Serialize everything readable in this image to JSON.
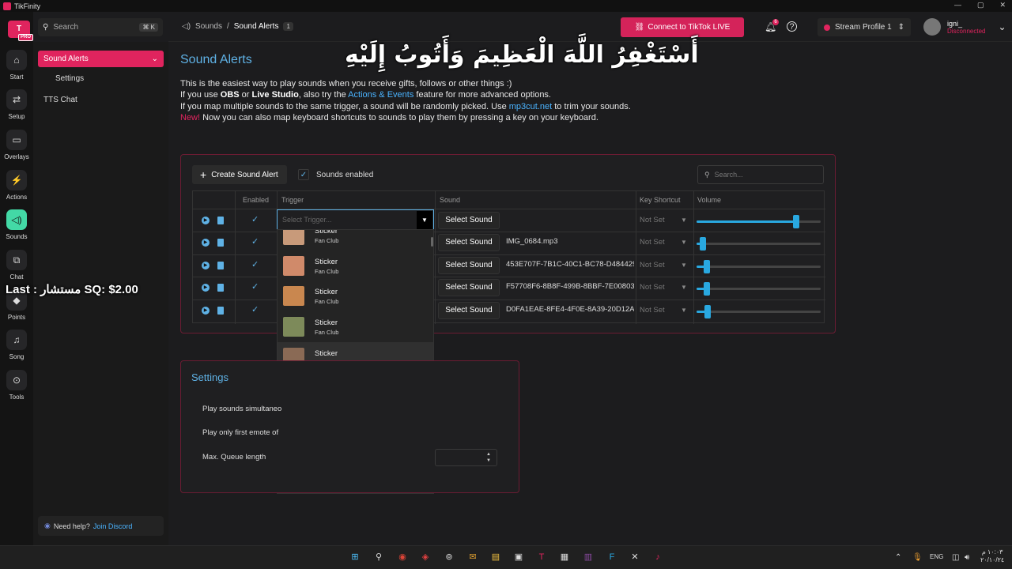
{
  "window": {
    "title": "TikFinity"
  },
  "brand": {
    "logo_text": "T",
    "badge": "PRO"
  },
  "rail": {
    "items": [
      {
        "label": "Start",
        "icon": "home-icon",
        "glyph": "⌂"
      },
      {
        "label": "Setup",
        "icon": "toggle-icon",
        "glyph": "⇄"
      },
      {
        "label": "Overlays",
        "icon": "monitor-icon",
        "glyph": "▭"
      },
      {
        "label": "Actions",
        "icon": "bolt-icon",
        "glyph": "⚡"
      },
      {
        "label": "Sounds",
        "icon": "speaker-icon",
        "glyph": "◁)"
      },
      {
        "label": "Chat",
        "icon": "chat-icon",
        "glyph": "⧉"
      },
      {
        "label": "Points",
        "icon": "points-icon",
        "glyph": "◆"
      },
      {
        "label": "Song",
        "icon": "music-icon",
        "glyph": "♫"
      },
      {
        "label": "Tools",
        "icon": "gamepad-icon",
        "glyph": "⊙"
      }
    ]
  },
  "sidebar": {
    "search_placeholder": "Search",
    "search_shortcut": "⌘ K",
    "main_item": "Sound Alerts",
    "sub_item": "Settings",
    "tts_item": "TTS Chat",
    "help_text": "Need help?",
    "help_link": "Join Discord"
  },
  "topbar": {
    "breadcrumb_root": "Sounds",
    "breadcrumb_sep": "/",
    "breadcrumb_current": "Sound Alerts",
    "breadcrumb_badge": "1",
    "connect_label": "Connect to TikTok LIVE",
    "notif_count": "6",
    "profile": "Stream Profile 1",
    "user_name": "igni_",
    "user_status": "Disconnected"
  },
  "page": {
    "title": "Sound Alerts",
    "desc_line1": "This is the easiest way to play sounds when you receive gifts, follows or other things :)",
    "desc_l2_a": "If you use ",
    "desc_l2_obs": "OBS",
    "desc_l2_b": " or ",
    "desc_l2_ls": "Live Studio",
    "desc_l2_c": ", also try the ",
    "desc_l2_link": "Actions & Events",
    "desc_l2_d": " feature for more advanced options.",
    "desc_l3_a": "If you map multiple sounds to the same trigger, a sound will be randomly picked. Use ",
    "desc_l3_link": "mp3cut.net",
    "desc_l3_b": " to trim your sounds.",
    "desc_l4_new": "New!",
    "desc_l4_text": " Now you can also map keyboard shortcuts to sounds to play them by pressing a key on your keyboard."
  },
  "alerts": {
    "create_label": "Create Sound Alert",
    "sounds_enabled_label": "Sounds enabled",
    "search_placeholder": "Search...",
    "columns": [
      "Enabled",
      "Trigger",
      "Sound",
      "Key Shortcut",
      "Volume"
    ],
    "trigger_placeholder": "Select Trigger...",
    "rows": [
      {
        "select_label": "Select Sound",
        "file": "",
        "key": "Not Set",
        "volume": 0.8
      },
      {
        "select_label": "Select Sound",
        "file": "IMG_0684.mp3",
        "key": "Not Set",
        "volume": 0.05
      },
      {
        "select_label": "Select Sound",
        "file": "453E707F-7B1C-40C1-BC78-D484429...",
        "key": "Not Set",
        "volume": 0.08
      },
      {
        "select_label": "Select Sound",
        "file": "F57708F6-8B8F-499B-8BBF-7E00803...",
        "key": "Not Set",
        "volume": 0.08
      },
      {
        "select_label": "Select Sound",
        "file": "D0FA1EAE-8FE4-4F0E-8A39-20D12A9...",
        "key": "Not Set",
        "volume": 0.09
      }
    ],
    "dropdown_items": [
      {
        "label": "Sticker",
        "sub": "Fan Club",
        "color": "#c89a7a"
      },
      {
        "label": "Sticker",
        "sub": "Fan Club",
        "color": "#d08a6a"
      },
      {
        "label": "Sticker",
        "sub": "Fan Club",
        "color": "#c9874f"
      },
      {
        "label": "Sticker",
        "sub": "Fan Club",
        "color": "#7d8a5a"
      },
      {
        "label": "Sticker",
        "sub": "Fan Club",
        "color": "#8a6a55"
      },
      {
        "label": "Sticker",
        "sub": "Fan Club",
        "color": "#6a4a3a"
      },
      {
        "label": "Sticker",
        "sub": "Fan Club",
        "color": "#8a6a8a"
      },
      {
        "label": "Sticker",
        "sub": "Fan Club",
        "color": "#6a8a5a"
      },
      {
        "label": "Sticker",
        "sub": "Fan Club",
        "color": "#dcdcdc"
      }
    ]
  },
  "settings": {
    "title": "Settings",
    "opt1": "Play sounds simultaneo",
    "opt2": "Play only first emote of",
    "opt3": "Max. Queue length"
  },
  "overlays": {
    "arabic": "أَسْتَغْفِرُ اللَّهَ الْعَظِيمَ وَأَتُوبُ إِلَيْهِ",
    "last_sq": "Last : مستشار SQ: $2.00"
  },
  "taskbar": {
    "lang": "ENG",
    "time": "١٠:٠٣ م",
    "date": "٢٠/١٠/٢٤",
    "mail_badge": "99+"
  },
  "colors": {
    "accent": "#e0245e",
    "blue": "#5fb2e6",
    "mint": "#43d9a6"
  }
}
